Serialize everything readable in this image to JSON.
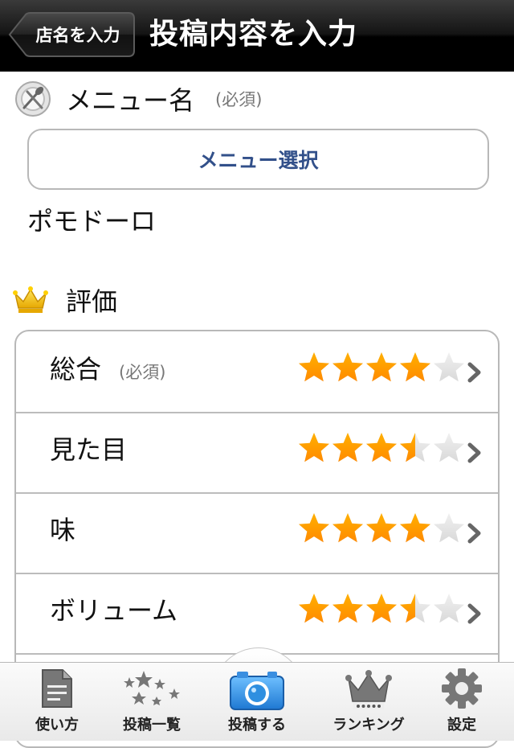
{
  "nav": {
    "back_label": "店名を入力",
    "title": "投稿内容を入力"
  },
  "menu_section": {
    "icon": "fork-spoon-plate-icon",
    "title": "メニュー名",
    "required": "(必須)",
    "select_button": "メニュー選択",
    "value": "ポモドーロ"
  },
  "rating_section": {
    "icon": "crown-icon",
    "title": "評価",
    "rows": [
      {
        "label": "総合",
        "required": "(必須)",
        "rating": 4.0
      },
      {
        "label": "見た目",
        "rating": 3.5
      },
      {
        "label": "味",
        "rating": 4.0
      },
      {
        "label": "ボリューム",
        "rating": 3.5
      }
    ],
    "max_rating": 5
  },
  "colors": {
    "star_on": "#ff8a00",
    "star_off": "#d9d9d9",
    "accent_text": "#32508a",
    "camera": "#2f8fe0"
  },
  "tabs": [
    {
      "label": "使い方",
      "icon": "document-icon"
    },
    {
      "label": "投稿一覧",
      "icon": "stars-icon"
    },
    {
      "label": "投稿する",
      "icon": "camera-icon",
      "selected": true
    },
    {
      "label": "ランキング",
      "icon": "crown-ranking-icon"
    },
    {
      "label": "設定",
      "icon": "gear-icon"
    }
  ]
}
